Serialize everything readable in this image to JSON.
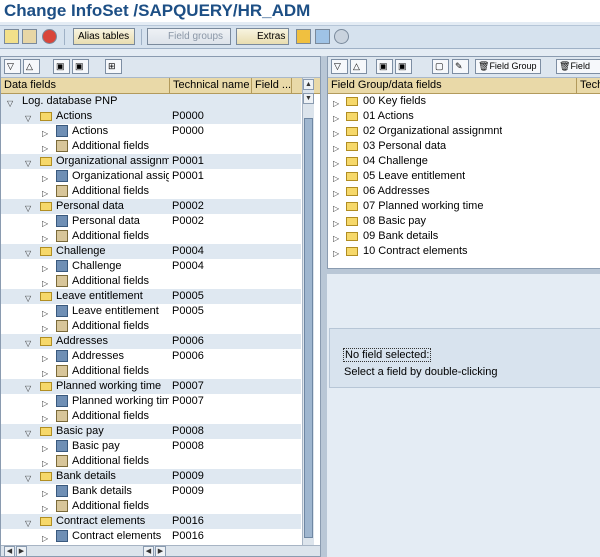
{
  "window": {
    "title": "Change InfoSet /SAPQUERY/HR_ADM"
  },
  "toolbar": {
    "alias_tables": "Alias tables",
    "field_groups": "Field groups",
    "extras": "Extras"
  },
  "left": {
    "columns": [
      "Data fields",
      "Technical name",
      "Field ..."
    ],
    "root": "Log. database PNP",
    "nodes": [
      {
        "label": "Actions",
        "tech": "P0000",
        "children": [
          {
            "label": "Actions",
            "tech": "P0000"
          },
          {
            "label": "Additional fields",
            "tech": ""
          }
        ]
      },
      {
        "label": "Organizational assignme",
        "tech": "P0001",
        "children": [
          {
            "label": "Organizational assigr",
            "tech": "P0001"
          },
          {
            "label": "Additional fields",
            "tech": ""
          }
        ]
      },
      {
        "label": "Personal data",
        "tech": "P0002",
        "children": [
          {
            "label": "Personal data",
            "tech": "P0002"
          },
          {
            "label": "Additional fields",
            "tech": ""
          }
        ]
      },
      {
        "label": "Challenge",
        "tech": "P0004",
        "children": [
          {
            "label": "Challenge",
            "tech": "P0004"
          },
          {
            "label": "Additional fields",
            "tech": ""
          }
        ]
      },
      {
        "label": "Leave entitlement",
        "tech": "P0005",
        "children": [
          {
            "label": "Leave entitlement",
            "tech": "P0005"
          },
          {
            "label": "Additional fields",
            "tech": ""
          }
        ]
      },
      {
        "label": "Addresses",
        "tech": "P0006",
        "children": [
          {
            "label": "Addresses",
            "tech": "P0006"
          },
          {
            "label": "Additional fields",
            "tech": ""
          }
        ]
      },
      {
        "label": "Planned working time",
        "tech": "P0007",
        "children": [
          {
            "label": "Planned working time",
            "tech": "P0007"
          },
          {
            "label": "Additional fields",
            "tech": ""
          }
        ]
      },
      {
        "label": "Basic pay",
        "tech": "P0008",
        "children": [
          {
            "label": "Basic pay",
            "tech": "P0008"
          },
          {
            "label": "Additional fields",
            "tech": ""
          }
        ]
      },
      {
        "label": "Bank details",
        "tech": "P0009",
        "children": [
          {
            "label": "Bank details",
            "tech": "P0009"
          },
          {
            "label": "Additional fields",
            "tech": ""
          }
        ]
      },
      {
        "label": "Contract elements",
        "tech": "P0016",
        "children": [
          {
            "label": "Contract elements",
            "tech": "P0016"
          }
        ]
      }
    ]
  },
  "right": {
    "toolbar": {
      "field_group": "Field Group",
      "field": "Field"
    },
    "columns": [
      "Field Group/data fields",
      "Tech"
    ],
    "groups": [
      "00 Key fields",
      "01 Actions",
      "02 Organizational assignmnt",
      "03 Personal data",
      "04 Challenge",
      "05 Leave entitlement",
      "06 Addresses",
      "07 Planned working time",
      "08 Basic pay",
      "09 Bank details",
      "10 Contract elements"
    ]
  },
  "info": {
    "no_field": "No field selected:",
    "hint": "Select a field by double-clicking"
  }
}
